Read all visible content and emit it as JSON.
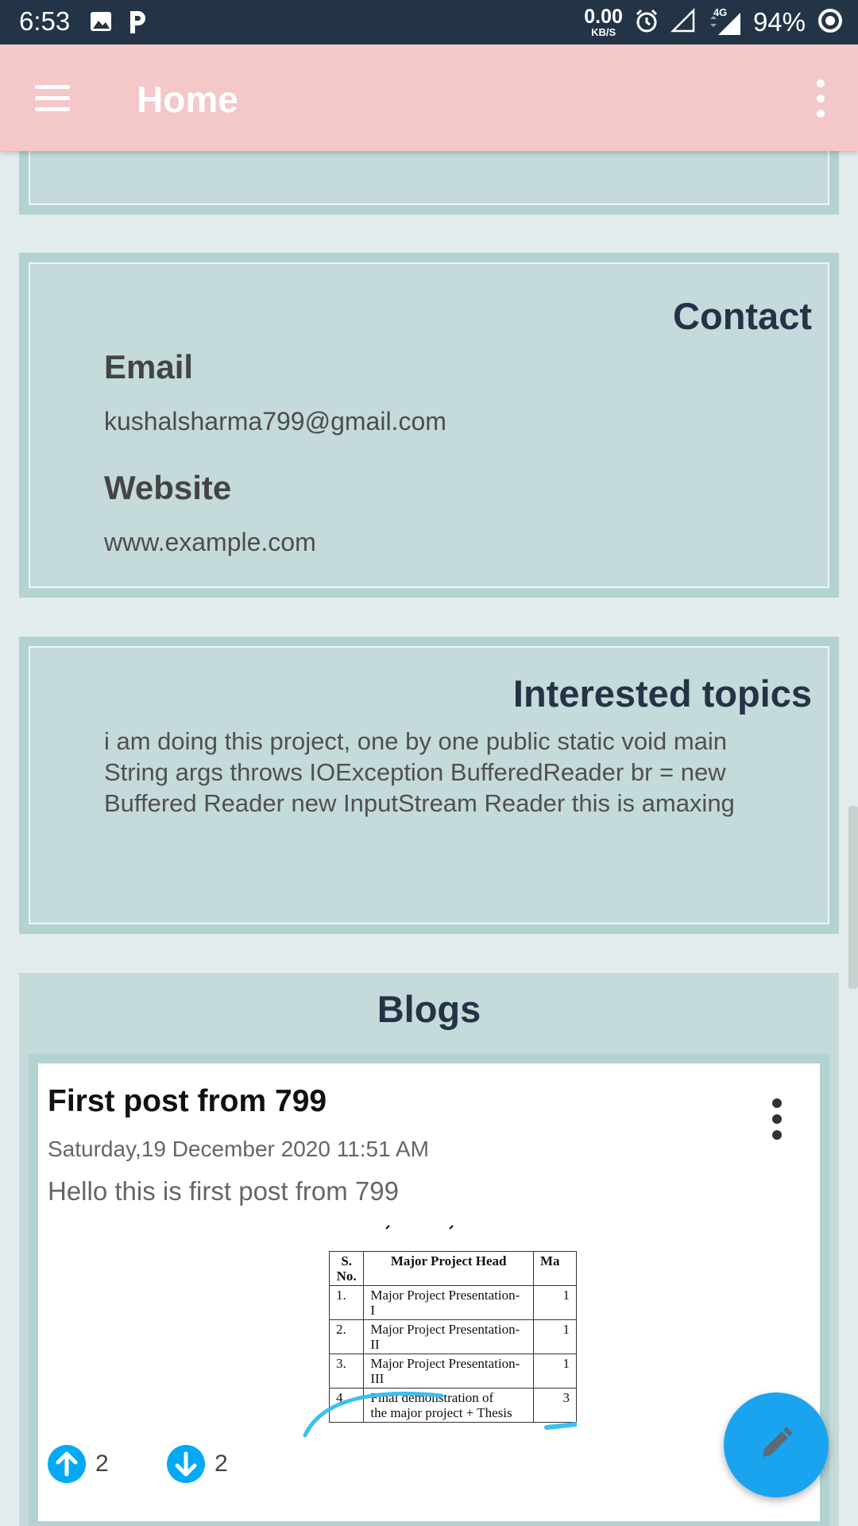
{
  "status_bar": {
    "time": "6:53",
    "net_speed_value": "0.00",
    "net_speed_unit": "KB/S",
    "network_type": "4G",
    "battery": "94%",
    "left_icons": [
      "image-icon",
      "p-icon"
    ],
    "right_icons": [
      "alarm-icon",
      "signal-empty-icon",
      "signal-4g-icon",
      "battery-ring-icon"
    ]
  },
  "app_bar": {
    "title": "Home",
    "menu_icon": "hamburger-icon",
    "more_icon": "more-vert-icon"
  },
  "contact": {
    "heading": "Contact",
    "email_label": "Email",
    "email_value": "kushalsharma799@gmail.com",
    "website_label": "Website",
    "website_value": "www.example.com"
  },
  "topics": {
    "heading": "Interested topics",
    "text": "i am doing this project, one by one public static void main String args throws IOException BufferedReader br = new Buffered Reader new InputStream Reader this is amaxing"
  },
  "blogs": {
    "heading": "Blogs",
    "post": {
      "title": "First post from 799",
      "date": "Saturday,19 December 2020 11:51 AM",
      "body": "Hello this is first post from 799",
      "upvotes": "2",
      "downvotes": "2",
      "image_table": {
        "headers": [
          "S.\nNo.",
          "Major Project Head",
          "Ma"
        ],
        "rows": [
          [
            "1.",
            "Major Project Presentation-\nI",
            "1"
          ],
          [
            "2.",
            "Major Project Presentation-\nII",
            "1"
          ],
          [
            "3.",
            "Major Project Presentation-\nIII",
            "1"
          ],
          [
            "4.",
            "Final demonstration of\nthe major project + Thesis",
            "3"
          ]
        ]
      }
    }
  },
  "fab": {
    "icon": "pencil-icon"
  },
  "colors": {
    "status_bar_bg": "#243447",
    "app_bar_bg": "#f4c7c9",
    "card_bg": "#c5dada",
    "card_border": "#b3d2d2",
    "heading_text": "#243447",
    "accent": "#03a9f4"
  }
}
